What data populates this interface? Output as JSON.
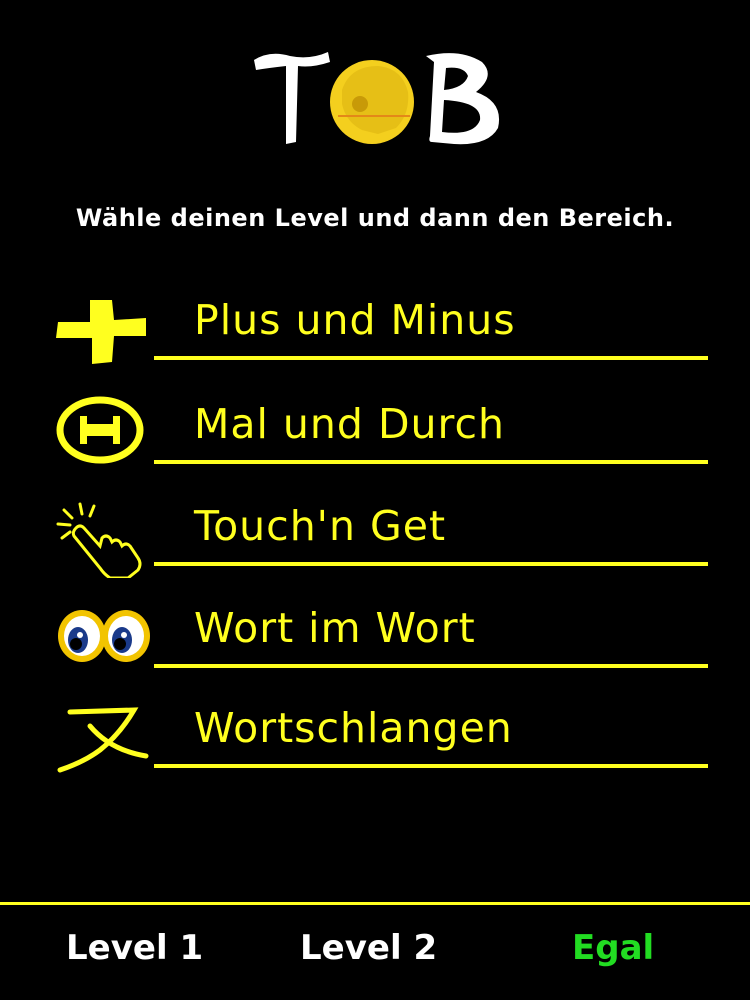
{
  "header": {
    "logo_text": "TOB",
    "instruction": "Wähle deinen Level und dann den Bereich."
  },
  "menu": {
    "items": [
      {
        "label": "Plus und Minus",
        "icon": "plus-icon"
      },
      {
        "label": "Mal und Durch",
        "icon": "theta-icon"
      },
      {
        "label": "Touch'n Get",
        "icon": "tap-hand-icon"
      },
      {
        "label": "Wort im Wort",
        "icon": "eyes-icon"
      },
      {
        "label": "Wortschlangen",
        "icon": "kanji-icon"
      }
    ]
  },
  "levels": {
    "level1": "Level 1",
    "level2": "Level 2",
    "egal": "Egal",
    "selected": "Egal"
  },
  "colors": {
    "background": "#000000",
    "accent": "#ffff1f",
    "selected_level": "#22dd22",
    "text": "#ffffff"
  }
}
